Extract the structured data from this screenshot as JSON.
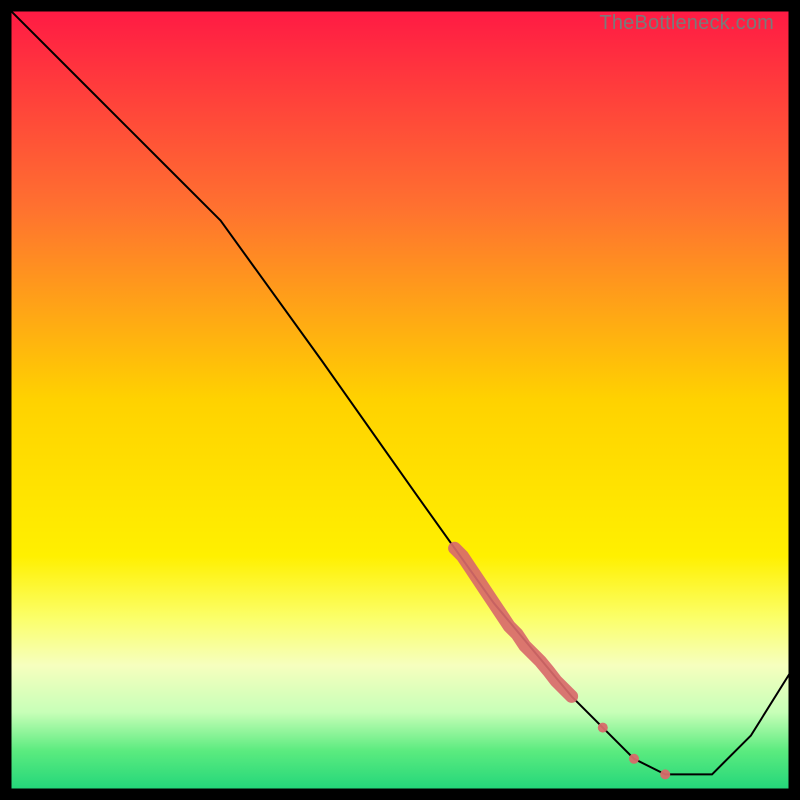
{
  "watermark": "TheBottleneck.com",
  "chart_data": {
    "type": "line",
    "title": "",
    "xlabel": "",
    "ylabel": "",
    "xlim": [
      0,
      100
    ],
    "ylim": [
      0,
      100
    ],
    "grid": false,
    "legend": false,
    "background_gradient": {
      "stops": [
        {
          "offset": 0.0,
          "color": "#ff1a44"
        },
        {
          "offset": 0.25,
          "color": "#ff7030"
        },
        {
          "offset": 0.5,
          "color": "#ffd200"
        },
        {
          "offset": 0.7,
          "color": "#fff000"
        },
        {
          "offset": 0.78,
          "color": "#fbff6a"
        },
        {
          "offset": 0.84,
          "color": "#f6ffbe"
        },
        {
          "offset": 0.9,
          "color": "#c8ffb8"
        },
        {
          "offset": 0.95,
          "color": "#5beb7f"
        },
        {
          "offset": 1.0,
          "color": "#22d67a"
        }
      ]
    },
    "series": [
      {
        "name": "curve",
        "color": "#000000",
        "stroke_width": 2,
        "x": [
          0,
          10,
          20,
          27,
          40,
          52,
          62,
          72,
          80,
          84,
          90,
          95,
          100
        ],
        "y": [
          100,
          90,
          80,
          73,
          55,
          38,
          24,
          12,
          4,
          2,
          2,
          7,
          15
        ]
      }
    ],
    "markers": {
      "name": "highlight",
      "color": "#d86a6a",
      "radius_large": 7,
      "radius_small": 5,
      "x": [
        57,
        58,
        59,
        60,
        61,
        62,
        63,
        64,
        65,
        66,
        67,
        68,
        69,
        70,
        71,
        72,
        76,
        80,
        84
      ],
      "y": [
        31,
        30,
        28.5,
        27,
        25.5,
        24,
        22.5,
        21,
        20,
        18.5,
        17.5,
        16.5,
        15.3,
        14,
        13,
        12,
        8,
        4,
        2
      ]
    }
  }
}
